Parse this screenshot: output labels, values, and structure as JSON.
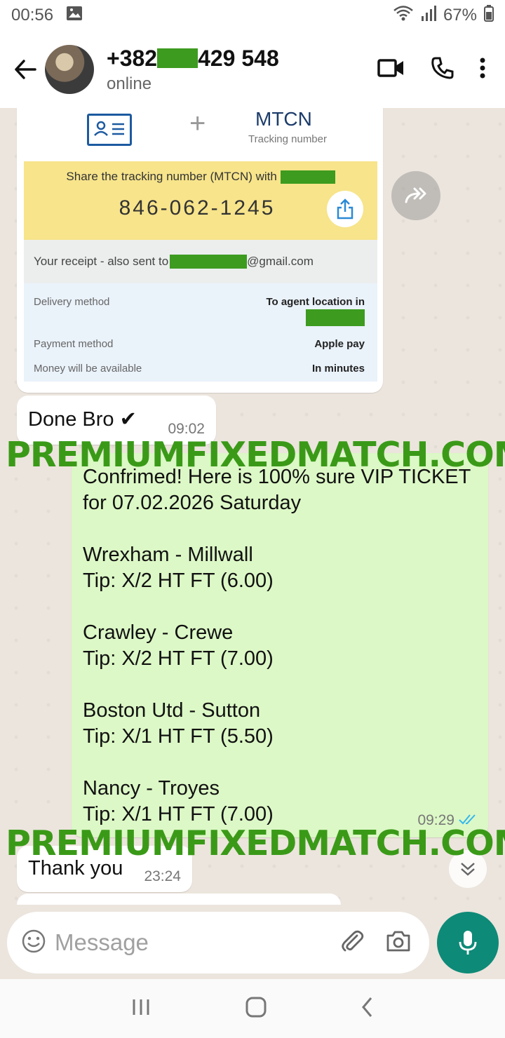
{
  "status_bar": {
    "time": "00:56",
    "battery": "67%"
  },
  "header": {
    "phone_prefix": "+382",
    "phone_suffix": "429 548",
    "status": "online"
  },
  "receipt": {
    "mtcn_label": "MTCN",
    "tracking_label": "Tracking number",
    "plus": "+",
    "share_text": "Share the tracking number (MTCN) with",
    "mtcn_number": "846-062-1245",
    "receipt_prefix": "Your receipt - also sent to",
    "receipt_suffix": "@gmail.com",
    "delivery_label": "Delivery method",
    "delivery_value": "To agent location in",
    "payment_label": "Payment method",
    "payment_value": "Apple pay",
    "availability_label": "Money will be available",
    "availability_value": "In minutes"
  },
  "messages": [
    {
      "text": "Done Bro ✔",
      "time": "09:02"
    },
    {
      "text": "Confrimed! Here is 100% sure VIP TICKET\nfor 07.02.2026 Saturday\n\nWrexham - Millwall\nTip: X/2 HT FT (6.00)\n\nCrawley - Crewe\nTip: X/2 HT FT (7.00)\n\nBoston Utd - Sutton\nTip: X/1 HT FT (5.50)\n\nNancy - Troyes\nTip: X/1 HT FT (7.00)",
      "time": "09:29"
    },
    {
      "text": "Thank you",
      "time": "23:24"
    }
  ],
  "watermark": "PREMIUMFIXEDMATCH.COM",
  "input": {
    "placeholder": "Message"
  },
  "colors": {
    "redaction": "#3d9b1f",
    "watermark": "#3a9a18",
    "mic": "#0e8a78",
    "out_bubble": "#dcf8c6",
    "read_ticks": "#34b7f1"
  }
}
